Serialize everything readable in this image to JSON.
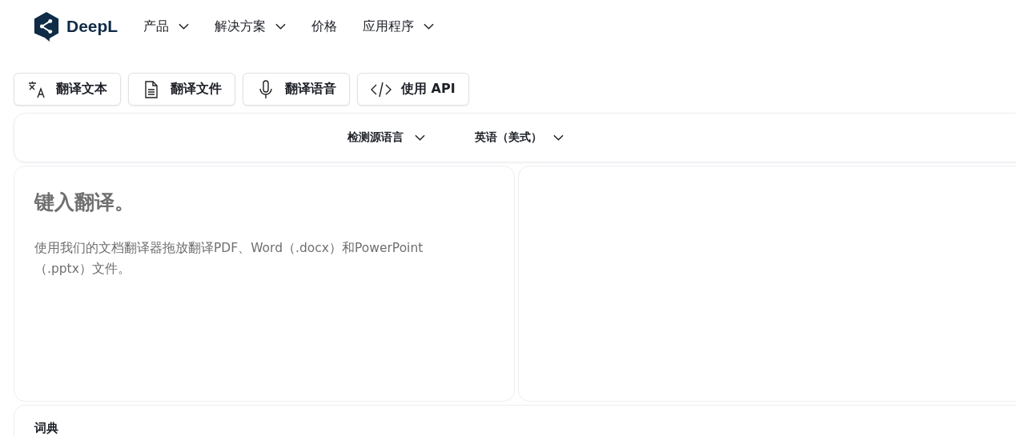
{
  "header": {
    "logo_text": "DeepL",
    "nav": [
      {
        "label": "产品",
        "dropdown": true
      },
      {
        "label": "解决方案",
        "dropdown": true
      },
      {
        "label": "价格",
        "dropdown": false
      },
      {
        "label": "应用程序",
        "dropdown": true
      }
    ]
  },
  "modes": [
    {
      "label": "翻译文本",
      "kind": "text"
    },
    {
      "label": "翻译文件",
      "kind": "file"
    },
    {
      "label": "翻译语音",
      "kind": "voice"
    },
    {
      "label": "使用 API",
      "kind": "api"
    }
  ],
  "languages": {
    "source": "检测源语言",
    "target": "英语（美式）"
  },
  "source_panel": {
    "placeholder": "键入翻译。",
    "hint": "使用我们的文档翻译器拖放翻译PDF、Word（.docx）和PowerPoint（.pptx）文件。"
  },
  "dictionary": {
    "title": "词典"
  }
}
